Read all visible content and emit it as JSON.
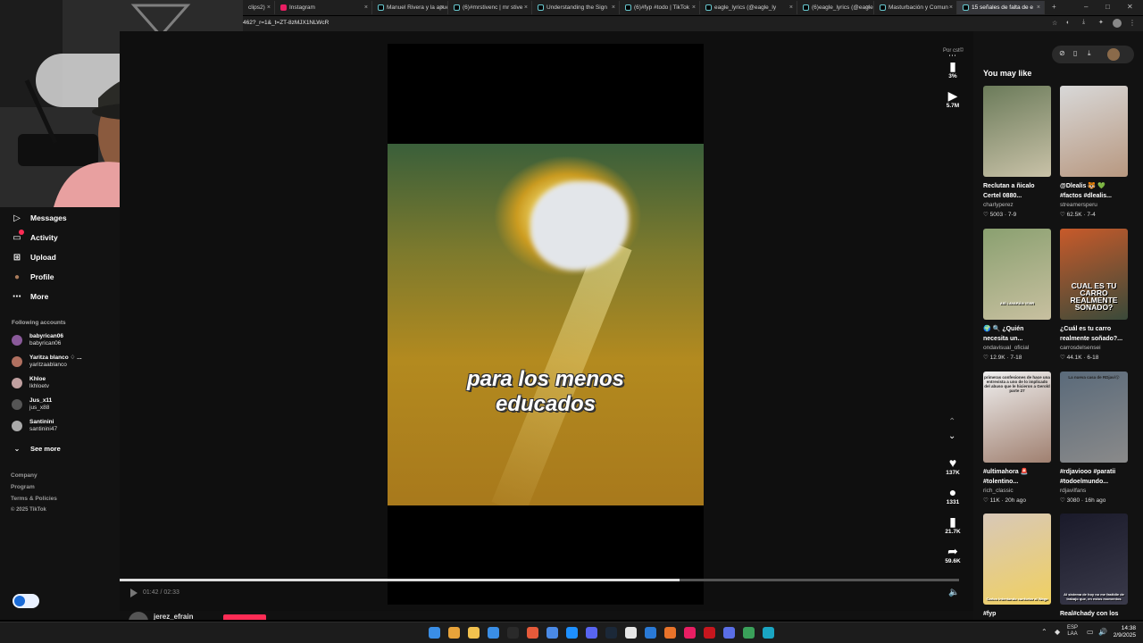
{
  "browser": {
    "tabs": [
      {
        "label": "clips2)"
      },
      {
        "label": "Instagram"
      },
      {
        "label": "Manuel Rivera y la apue"
      },
      {
        "label": "(6)#mrstivenc | mr stive"
      },
      {
        "label": "Understanding the Sign"
      },
      {
        "label": "(6)#fyp #todo | TikTok"
      },
      {
        "label": "eagle_lyrics (@eagle_ly"
      },
      {
        "label": "(6)eagle_lyrics (@eagle"
      },
      {
        "label": "Masturbación y Comun"
      },
      {
        "label": "15 señales de falta de e"
      }
    ],
    "tab_close": "×",
    "new_tab": "+",
    "url": "462?_r=1&_t=ZT-8zMJX1NLWcR",
    "window_controls": {
      "minimize": "–",
      "maximize": "□",
      "close": "✕"
    }
  },
  "sidebar": {
    "items": [
      {
        "label": "Messages",
        "icon": "messages-icon",
        "glyph": "▷"
      },
      {
        "label": "Activity",
        "icon": "activity-icon",
        "glyph": "▭"
      },
      {
        "label": "Upload",
        "icon": "upload-icon",
        "glyph": "⊞"
      },
      {
        "label": "Profile",
        "icon": "profile-icon",
        "glyph": "●"
      },
      {
        "label": "More",
        "icon": "more-icon",
        "glyph": "⋯"
      }
    ],
    "activity_badge_color": "#fe2c55",
    "following_header": "Following accounts",
    "following": [
      {
        "name": "babyrican06",
        "handle": "babyrican06",
        "color": "#8a5a9a"
      },
      {
        "name": "Yaritza blanco ♢ ...",
        "handle": "yaritzaablanco",
        "color": "#b07060"
      },
      {
        "name": "Khloe",
        "handle": "lkhloetv",
        "color": "#c0a0a0"
      },
      {
        "name": "Jus_x11",
        "handle": "jus_x88",
        "color": "#555"
      },
      {
        "name": "Santinini",
        "handle": "santinini47",
        "color": "#aaa"
      }
    ],
    "see_more": "See more",
    "footer": [
      "Company",
      "Program",
      "Terms & Policies",
      "© 2025 TikTok"
    ]
  },
  "video": {
    "caption_line1": "para los menos",
    "caption_line2": "educados",
    "time": "01:42 / 02:33",
    "progress_fraction": 0.667,
    "powered_label": "Por cst©",
    "rail": [
      {
        "icon": "stats-icon",
        "glyph": "▮",
        "count": "3%"
      },
      {
        "icon": "plays-icon",
        "glyph": "▶",
        "count": "5.7M"
      },
      {
        "icon": "like-icon",
        "glyph": "♥",
        "count": "137K"
      },
      {
        "icon": "comment-icon",
        "glyph": "●",
        "count": "1331"
      },
      {
        "icon": "bookmark-icon",
        "glyph": "▮",
        "count": "21.7K"
      },
      {
        "icon": "share-icon",
        "glyph": "➦",
        "count": "59.6K"
      }
    ],
    "nav_up": "⌃",
    "nav_down": "⌄",
    "more": "⋯",
    "author": "jerez_efrain"
  },
  "recommended": {
    "title": "You may like",
    "cards": [
      {
        "title": "Reclutan a ñicalo",
        "subtitle": "Certel 0880...",
        "user": "charlyperez",
        "stats": "♡ 5003 · 7-9",
        "colors": [
          "#6b7b5a",
          "#c9c2a8"
        ],
        "overlay": ""
      },
      {
        "title": "@Dlealis 🐯 💚",
        "subtitle": "#factos #dlealis...",
        "user": "streamersperu",
        "stats": "♡ 62.5K · 7-4",
        "colors": [
          "#d8d8d8",
          "#b89880"
        ],
        "overlay": ""
      },
      {
        "title": "🌍 🔍 ¿Quién",
        "subtitle": "necesita un...",
        "user": "ondavisual_oficial",
        "stats": "♡ 12.9K · 7-18",
        "colors": [
          "#8aa070",
          "#c8c0a0"
        ],
        "overlay": "ASÍ LAVARÁN VIVIR"
      },
      {
        "title": "¿Cuál es tu carro",
        "subtitle": "realmente soñado?...",
        "user": "carrosdelsensei",
        "stats": "♡ 44.1K · 6-18",
        "colors": [
          "#c85a2a",
          "#3a4a3a"
        ],
        "overlay": "CUAL ES TU CARRO REALMENTE SONADO?"
      },
      {
        "title": "#ultimahora 🚨",
        "subtitle": "#tolentino...",
        "user": "rich_classic",
        "stats": "♡ 11K · 20h ago",
        "colors": [
          "#f0f0f0",
          "#a08070"
        ],
        "overlay": "primeras confesiones de hace una entrevista a uno de lo implicado del abuso que le hicieron a Gerold parte 27"
      },
      {
        "title": "#rdjaviooo #paratii",
        "subtitle": "#todoelmundo...",
        "user": "rdjavilfans",
        "stats": "♡ 3080 · 16h ago",
        "colors": [
          "#5a6a7a",
          "#8a8a8a"
        ],
        "overlay": "La nueva casa de RDjavi😮"
      },
      {
        "title": "#fyp",
        "subtitle": "",
        "user": "",
        "stats": "",
        "colors": [
          "#d8c8b8",
          "#f0d060"
        ],
        "overlay": "Carlos Intentando confortar al Wago"
      },
      {
        "title": "Real#chady con los",
        "subtitle": "",
        "user": "",
        "stats": "",
        "colors": [
          "#1a1a2a",
          "#3a3a4a"
        ],
        "overlay": "Al sistema de hoy no me fastidie de trabajo que, en estos momentos"
      }
    ]
  },
  "taskbar": {
    "lang_line1": "ESP",
    "lang_line2": "LAA",
    "time": "14:38",
    "date": "2/9/2025",
    "app_colors": [
      "#3a8ee6",
      "#e8a33a",
      "#f2c14e",
      "#3a8ee6",
      "#2a2a2a",
      "#e65a3a",
      "#4a8ae6",
      "#1e90ff",
      "#5865f2",
      "#1b2838",
      "#e6e6e6",
      "#2a7ad6",
      "#e8732a",
      "#e91e63",
      "#c7161e",
      "#5a6ee6",
      "#3aa05a",
      "#1aa5c2"
    ]
  }
}
